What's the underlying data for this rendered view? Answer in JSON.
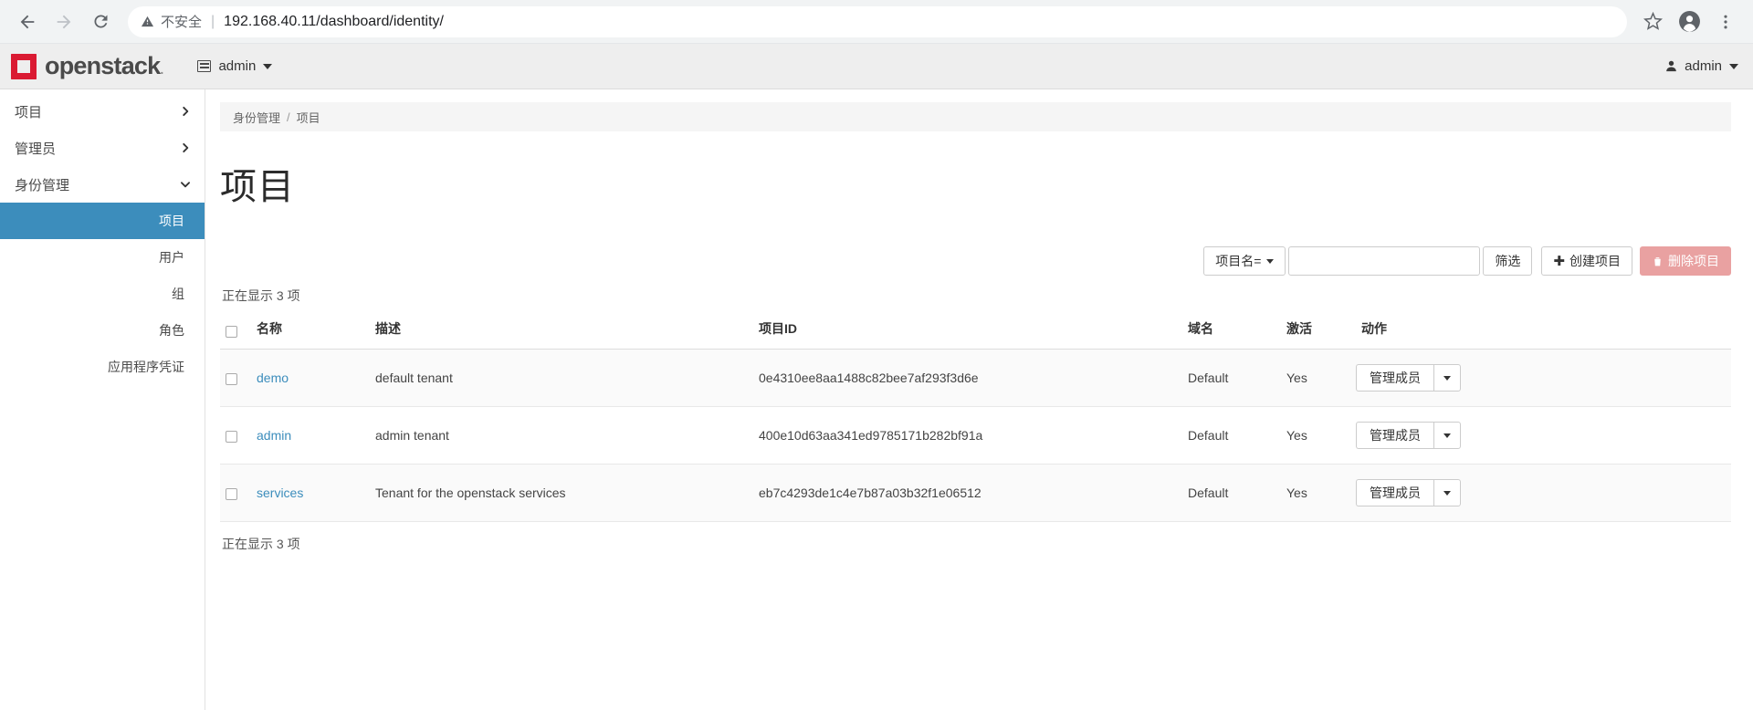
{
  "browser": {
    "back_icon": "back-arrow-icon",
    "forward_icon": "forward-arrow-icon",
    "reload_icon": "reload-icon",
    "security_warning": "不安全",
    "separator": "|",
    "url": "192.168.40.11/dashboard/identity/",
    "bookmark_icon": "star-icon",
    "profile_icon": "profile-avatar-icon",
    "menu_icon": "kebab-menu-icon"
  },
  "header": {
    "logo_text": "openstack",
    "logo_dot": ".",
    "project_context": "admin",
    "user_name": "admin"
  },
  "sidebar": {
    "groups": [
      {
        "label": "项目",
        "state": "collapsed"
      },
      {
        "label": "管理员",
        "state": "collapsed"
      },
      {
        "label": "身份管理",
        "state": "expanded"
      }
    ],
    "sub_items": [
      {
        "label": "项目",
        "active": true
      },
      {
        "label": "用户",
        "active": false
      },
      {
        "label": "组",
        "active": false
      },
      {
        "label": "角色",
        "active": false
      },
      {
        "label": "应用程序凭证",
        "active": false
      }
    ]
  },
  "breadcrumb": {
    "parent": "身份管理",
    "separator": "/",
    "current": "项目"
  },
  "page": {
    "title": "项目",
    "count_top": "正在显示 3 项",
    "count_bottom": "正在显示 3 项"
  },
  "toolbar": {
    "filter_key_label": "项目名=",
    "filter_input_value": "",
    "filter_input_placeholder": "",
    "filter_button": "筛选",
    "create_button": "创建项目",
    "create_icon": "plus-icon",
    "delete_button": "删除项目",
    "delete_icon": "trash-icon",
    "danger_color": "#e9a1a1",
    "accent_color": "#3c8dbc"
  },
  "table": {
    "headers": {
      "select_all": "select-all-checkbox",
      "name": "名称",
      "description": "描述",
      "project_id": "项目ID",
      "domain": "域名",
      "enabled": "激活",
      "actions": "动作"
    },
    "rows": [
      {
        "name": "demo",
        "description": "default tenant",
        "project_id": "0e4310ee8aa1488c82bee7af293f3d6e",
        "domain": "Default",
        "enabled": "Yes",
        "action_label": "管理成员"
      },
      {
        "name": "admin",
        "description": "admin tenant",
        "project_id": "400e10d63aa341ed9785171b282bf91a",
        "domain": "Default",
        "enabled": "Yes",
        "action_label": "管理成员"
      },
      {
        "name": "services",
        "description": "Tenant for the openstack services",
        "project_id": "eb7c4293de1c4e7b87a03b32f1e06512",
        "domain": "Default",
        "enabled": "Yes",
        "action_label": "管理成员"
      }
    ]
  }
}
